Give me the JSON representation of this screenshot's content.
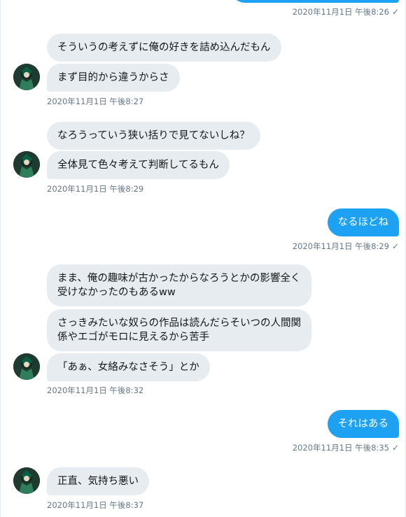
{
  "colors": {
    "incoming_bubble": "#e6ecf0",
    "outgoing_bubble": "#1da1f2",
    "timestamp": "#657786"
  },
  "check_glyph": "✓",
  "messages": [
    {
      "dir": "out",
      "timestamp": "2020年11月1日 午後8:26"
    },
    {
      "dir": "in",
      "lines": [
        "そういうの考えずに俺の好きを詰め込んだもん",
        "まず目的から違うからさ"
      ],
      "timestamp": "2020年11月1日 午後8:27"
    },
    {
      "dir": "in",
      "lines": [
        "なろうっていう狭い括りで見てないしね？",
        "全体見て色々考えて判断してるもん"
      ],
      "timestamp": "2020年11月1日 午後8:29"
    },
    {
      "dir": "out",
      "lines": [
        "なるほどね"
      ],
      "timestamp": "2020年11月1日 午後8:29"
    },
    {
      "dir": "in",
      "lines": [
        "まま、俺の趣味が古かったからなろうとかの影響全く受けなかったのもあるww",
        "さっきみたいな奴らの作品は読んだらそいつの人間関係やエゴがモロに見えるから苦手",
        "「あぁ、女絡みなさそう」とか"
      ],
      "timestamp": "2020年11月1日 午後8:32"
    },
    {
      "dir": "out",
      "lines": [
        "それはある"
      ],
      "timestamp": "2020年11月1日 午後8:35"
    },
    {
      "dir": "in",
      "lines": [
        "正直、気持ち悪い"
      ],
      "timestamp": "2020年11月1日 午後8:37"
    }
  ]
}
